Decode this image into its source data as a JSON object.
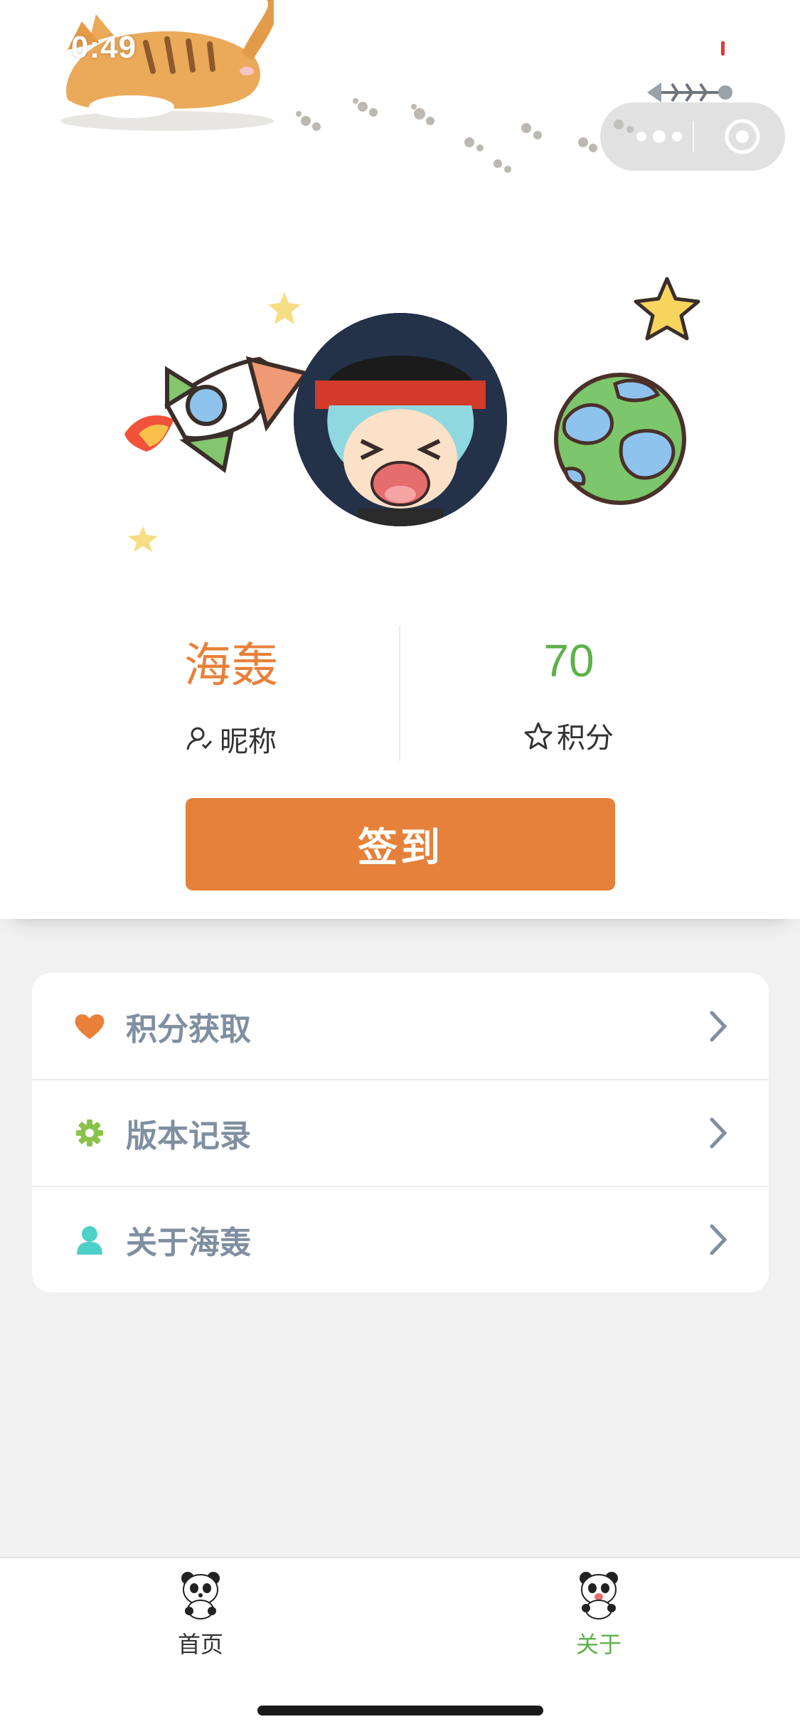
{
  "status_bar": {
    "time": "0:49"
  },
  "profile": {
    "nickname_value": "海轰",
    "nickname_label": "昵称",
    "points_value": "70",
    "points_label": "积分",
    "sign_in_label": "签到"
  },
  "menu": {
    "items": [
      {
        "label": "积分获取",
        "icon": "heart-icon",
        "icon_color": "#e8803a"
      },
      {
        "label": "版本记录",
        "icon": "gear-icon",
        "icon_color": "#8bc34a"
      },
      {
        "label": "关于海轰",
        "icon": "person-icon",
        "icon_color": "#4dd0c8"
      }
    ]
  },
  "tabbar": {
    "tabs": [
      {
        "label": "首页",
        "icon": "panda-icon",
        "active": false
      },
      {
        "label": "关于",
        "icon": "panda-icon",
        "active": true
      }
    ],
    "active_color": "#5db249",
    "inactive_color": "#333333"
  },
  "colors": {
    "accent": "#e5813a",
    "points_green": "#5db249",
    "background": "#f1f1f1"
  }
}
